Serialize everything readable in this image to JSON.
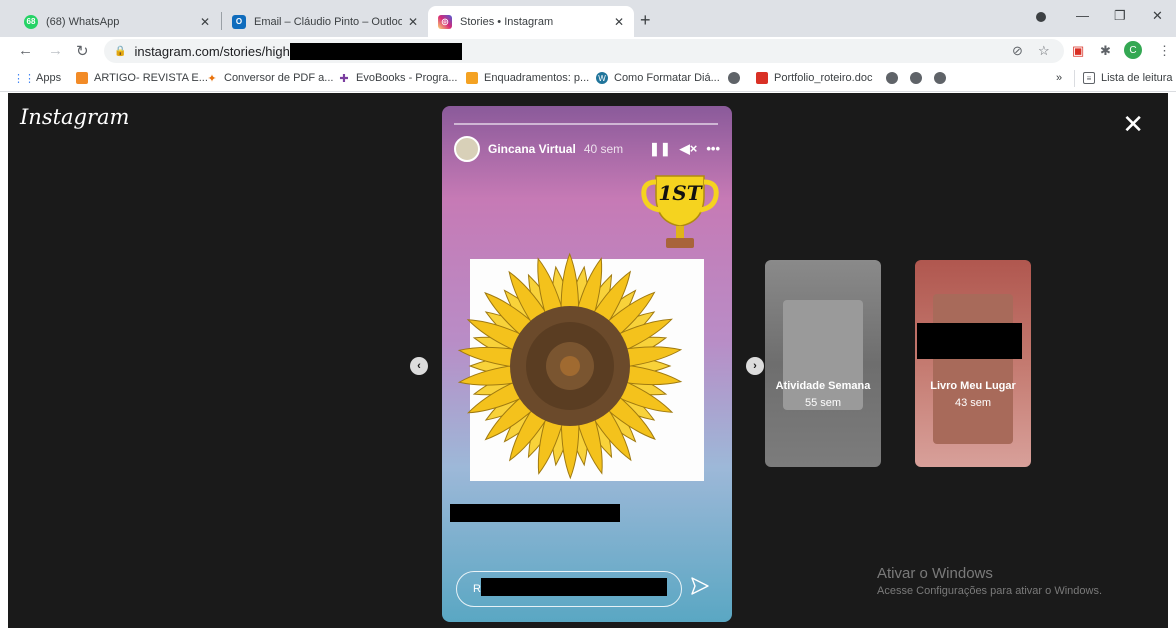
{
  "tabs": [
    {
      "label": "(68) WhatsApp",
      "badge": "68",
      "icon": "whatsapp-icon"
    },
    {
      "label": "Email – Cláudio Pinto – Outlook",
      "icon": "outlook-icon"
    },
    {
      "label": "Stories • Instagram",
      "icon": "instagram-icon",
      "active": true
    }
  ],
  "address": {
    "url": "instagram.com/stories/high"
  },
  "bookmarks": {
    "apps": "Apps",
    "items": [
      "ARTIGO- REVISTA E...",
      "Conversor de PDF a...",
      "EvoBooks - Progra...",
      "Enquadramentos: p...",
      "Como Formatar Diá...",
      "Portfolio_roteiro.doc"
    ],
    "more": "»",
    "reading_list": "Lista de leitura"
  },
  "instagram": {
    "logo": "Instagram",
    "story": {
      "username": "Gincana Virtual",
      "time": "40 sem",
      "trophy_text": "1ST",
      "reply_prefix": "R"
    },
    "next_stories": [
      {
        "title": "Atividade Semana",
        "time": "55 sem"
      },
      {
        "title": "Livro Meu Lugar",
        "time": "43 sem"
      }
    ]
  },
  "watermark": {
    "title": "Ativar o Windows",
    "subtitle": "Acesse Configurações para ativar o Windows."
  },
  "colors": {
    "viewer_bg": "#1a1a1a",
    "tabbar_bg": "#dee1e6",
    "story_gradient_top": "#c67ab5",
    "story_gradient_bottom": "#5aa7c3"
  }
}
